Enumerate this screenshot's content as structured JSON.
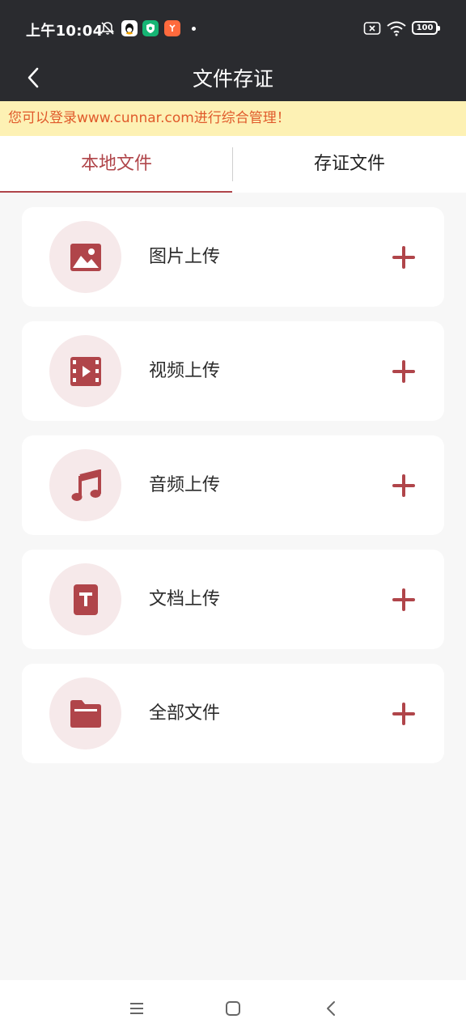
{
  "status_bar": {
    "time": "上午10:04",
    "icons": [
      "mute-bell-icon",
      "qq-app-icon",
      "shield-app-icon",
      "orange-app-icon",
      "notification-dot",
      "sim-no-service-icon",
      "wifi-icon",
      "battery-icon"
    ],
    "battery_level": "100"
  },
  "header": {
    "title": "文件存证",
    "back_icon": "chevron-left-icon"
  },
  "notice": {
    "text": "您可以登录www.cunnar.com进行综合管理！"
  },
  "tabs": [
    {
      "label": "本地文件",
      "active": true
    },
    {
      "label": "存证文件",
      "active": false
    }
  ],
  "items": [
    {
      "label": "图片上传",
      "icon": "image-icon",
      "action_icon": "plus-icon"
    },
    {
      "label": "视频上传",
      "icon": "film-icon",
      "action_icon": "plus-icon"
    },
    {
      "label": "音频上传",
      "icon": "music-note-icon",
      "action_icon": "plus-icon"
    },
    {
      "label": "文档上传",
      "icon": "text-document-icon",
      "action_icon": "plus-icon"
    },
    {
      "label": "全部文件",
      "icon": "folder-icon",
      "action_icon": "plus-icon"
    }
  ],
  "colors": {
    "accent": "#b0454a",
    "header_bg": "#2a2b2f",
    "notice_bg": "#fdf1b4",
    "notice_text": "#e05a2b",
    "icon_circle_bg": "#f6e9ea"
  },
  "nav_bar": {
    "buttons": [
      "menu-icon",
      "home-square-icon",
      "back-chevron-icon"
    ]
  }
}
